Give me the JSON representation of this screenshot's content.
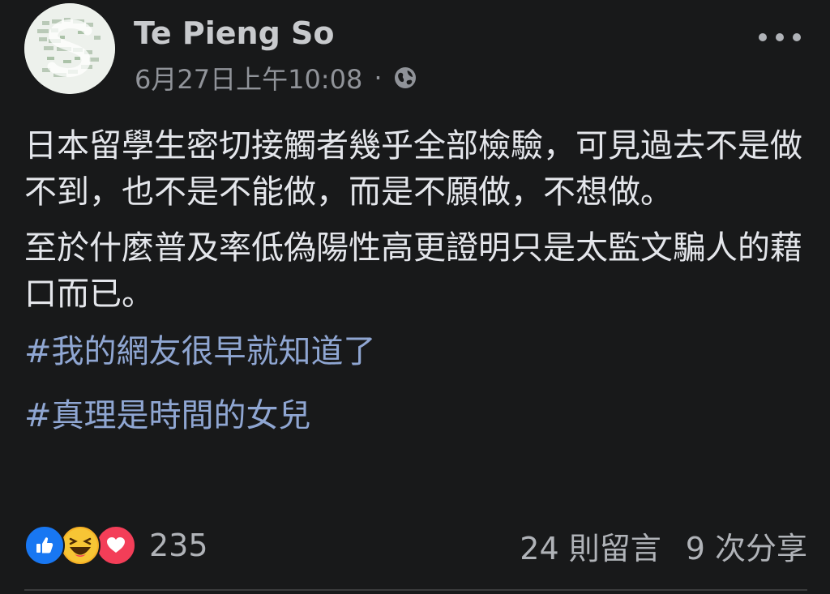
{
  "post": {
    "author": "Te Pieng So",
    "timestamp": "6月27日上午10:08",
    "separator": "·",
    "privacy_icon": "globe-icon",
    "more_icon": "more-horizontal-icon",
    "paragraphs": [
      "日本留學生密切接觸者幾乎全部檢驗，可見過去不是做不到，也不是不能做，而是不願做，不想做。",
      "至於什麼普及率低偽陽性高更證明只是太監文騙人的藉口而已。"
    ],
    "hashtags": [
      "#我的網友很早就知道了",
      "#真理是時間的女兒"
    ],
    "reactions": {
      "icons": [
        "like-icon",
        "haha-icon",
        "love-icon"
      ],
      "count": "235"
    },
    "comments": "24 則留言",
    "shares": "9 次分享"
  },
  "colors": {
    "background": "#18191a",
    "hashtag": "#8fa6d2",
    "like": "#1877f2",
    "haha": "#f7b125",
    "love": "#f33e58"
  }
}
